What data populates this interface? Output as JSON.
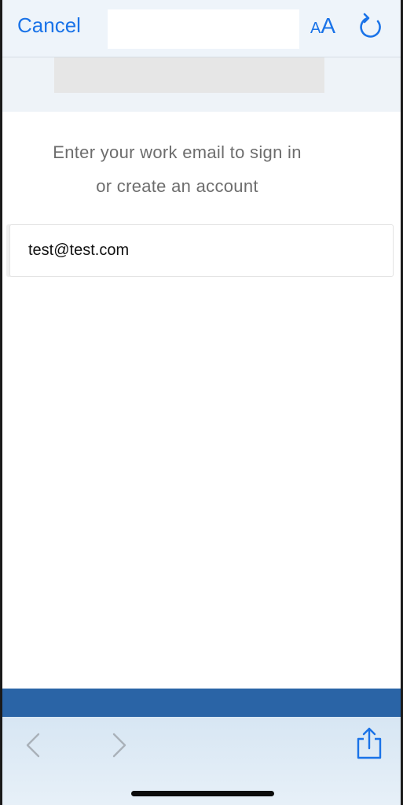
{
  "browser": {
    "cancel_label": "Cancel",
    "text_size_small": "A",
    "text_size_large": "A",
    "icons": {
      "reload": "reload-icon",
      "back": "chevron-left-icon",
      "forward": "chevron-right-icon",
      "share": "share-icon"
    }
  },
  "page": {
    "prompt_line1": "Enter your work email to sign in",
    "prompt_line2": "or create an account",
    "email_value": "test@test.com"
  },
  "colors": {
    "accent": "#1a73e8",
    "band": "#2a64a6",
    "prompt_text": "#6d6d6d",
    "nav_disabled": "#a9b1b9"
  }
}
